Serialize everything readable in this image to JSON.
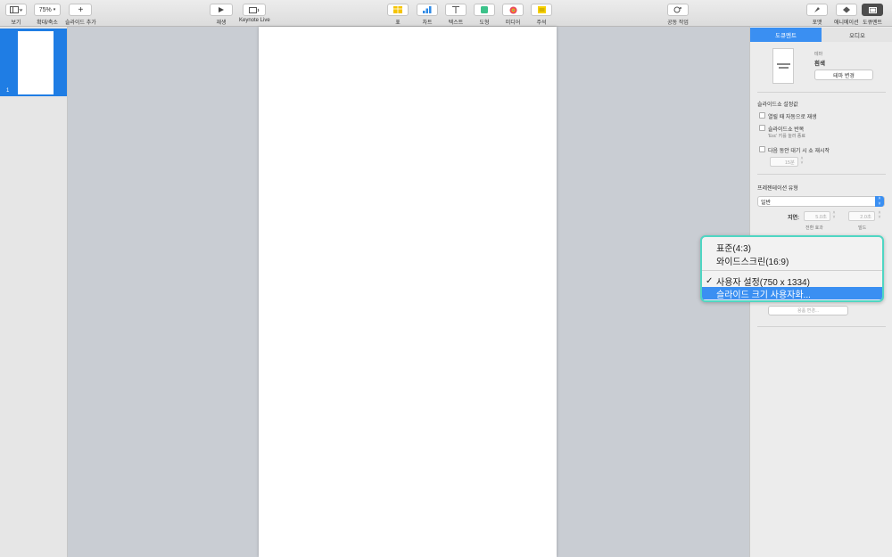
{
  "toolbar": {
    "view_label": "보기",
    "zoom_value": "75%",
    "zoom_label": "확대/축소",
    "add_slide_label": "슬라이드 추가",
    "play_label": "재생",
    "keynote_live_label": "Keynote Live",
    "table_label": "표",
    "chart_label": "차트",
    "text_label": "텍스트",
    "shape_label": "도형",
    "media_label": "미디어",
    "comment_label": "주석",
    "collaborate_label": "공동 작업",
    "format_label": "포맷",
    "animate_label": "애니메이션",
    "document_label": "도큐멘트"
  },
  "sidebar": {
    "slides": [
      {
        "number": "1"
      }
    ]
  },
  "inspector": {
    "tabs": [
      {
        "label": "도큐멘트"
      },
      {
        "label": "오디오"
      }
    ],
    "theme_caption": "테마",
    "theme_name": "흰색",
    "change_theme_label": "테마 변경",
    "slideshow_settings_title": "슬라이드쇼 설정값",
    "autoplay_label": "열릴 때 자동으로 재생",
    "loop_label": "슬라이드쇼 반복",
    "loop_hint": "'Esc' 키를 눌러 종료",
    "restart_label": "다음 동안 대기 시 쇼 재시작",
    "restart_value": "15분",
    "presentation_type_title": "프레젠테이션 유형",
    "presentation_type_value": "일반",
    "delay_label": "지연:",
    "transition_value": "5.0초",
    "build_value": "2.0초",
    "transition_caption": "전환 효과",
    "build_caption": "빌드",
    "change_button_label": "용품 변경..."
  },
  "slide_size_menu": {
    "items": [
      {
        "label": "표준(4:3)",
        "checked": false,
        "highlighted": false
      },
      {
        "label": "와이드스크린(16:9)",
        "checked": false,
        "highlighted": false
      },
      {
        "label": "사용자 설정(750 x 1334)",
        "checked": true,
        "highlighted": false
      },
      {
        "label": "슬라이드 크기 사용자화...",
        "checked": false,
        "highlighted": true
      }
    ],
    "check_mark": "✓"
  },
  "colors": {
    "accent": "#3a8ff2",
    "highlight_border": "#4fd6c3"
  }
}
